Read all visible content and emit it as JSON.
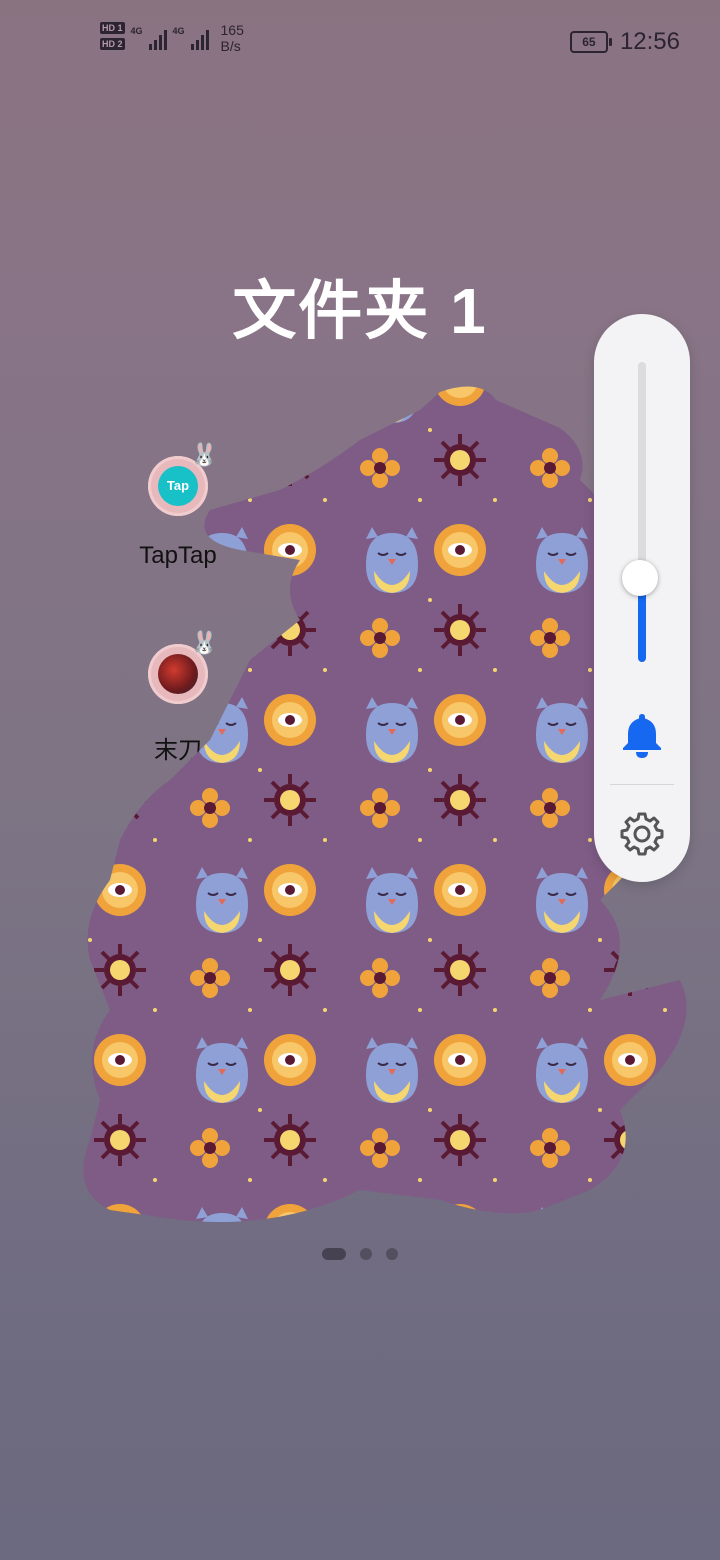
{
  "status_bar": {
    "sim1": "HD 1",
    "sim2": "HD 2",
    "network1": "4G",
    "network2": "4G",
    "speed_value": "165",
    "speed_unit": "B/s",
    "battery": "65",
    "time": "12:56"
  },
  "folder": {
    "title": "文件夹 1",
    "apps": [
      {
        "label": "TapTap",
        "icon": "taptap-icon",
        "badge": "bunny-icon"
      },
      {
        "label": "末刀",
        "icon": "modao-game-icon",
        "badge": "bunny-icon"
      }
    ]
  },
  "pager": {
    "total": 3,
    "active": 1
  },
  "volume_panel": {
    "level": 0.28,
    "mode_icon": "bell-icon",
    "settings_icon": "gear-icon",
    "accent": "#1768f0"
  },
  "colors": {
    "scribble_purple": "#7e5c86",
    "owl_blue": "#8ea0d6",
    "sun_orange": "#f0a33b",
    "dark_maroon": "#5a1a33"
  }
}
